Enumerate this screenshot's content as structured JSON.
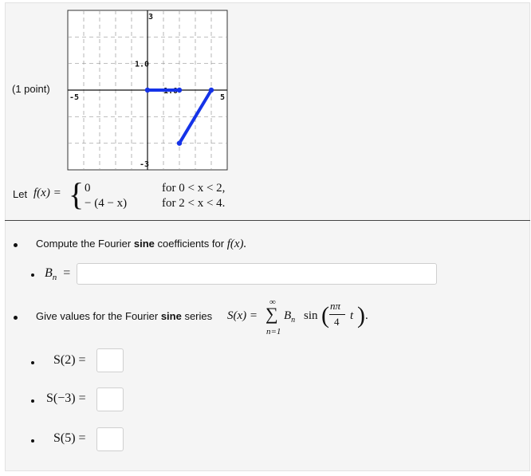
{
  "problem": {
    "points": "(1 point)",
    "let_prefix": "Let",
    "fx_label": "f(x) =",
    "piece1_expr": "0",
    "piece1_cond": "for  0 < x < 2,",
    "piece2_expr": "− (4 − x)",
    "piece2_cond": "for  2 < x < 4."
  },
  "graph": {
    "tick_labels": [
      "3",
      "1.0",
      "-1.0",
      "-5",
      "5",
      "-3"
    ],
    "segments": [
      {
        "x": [
          0,
          2
        ],
        "y": [
          0,
          0
        ]
      },
      {
        "x": [
          2,
          4
        ],
        "y": [
          -2,
          0
        ]
      }
    ],
    "xlim": [
      -5,
      5
    ],
    "ylim": [
      -3,
      3
    ],
    "line_color": "#1533e8"
  },
  "q1": {
    "text_before": "Compute the Fourier",
    "bold_word": "sine",
    "text_after": "coefficients for",
    "fx": "f(x).",
    "bn_label": "B",
    "bn_sub": "n",
    "eq": "=",
    "bn_value": ""
  },
  "q2": {
    "text_before": "Give values for the Fourier",
    "bold_word": "sine",
    "text_after": "series",
    "sx": "S(x) =",
    "sum_top": "∞",
    "sum_sym": "∑",
    "sum_bottom": "n=1",
    "b": "B",
    "b_sub": "n",
    "sin": "sin",
    "frac_num": "nπ",
    "frac_den": "4",
    "t": "t",
    "period": "."
  },
  "answers": [
    {
      "label": "S(2) =",
      "value": ""
    },
    {
      "label": "S(−3) =",
      "value": ""
    },
    {
      "label": "S(5) =",
      "value": ""
    }
  ]
}
